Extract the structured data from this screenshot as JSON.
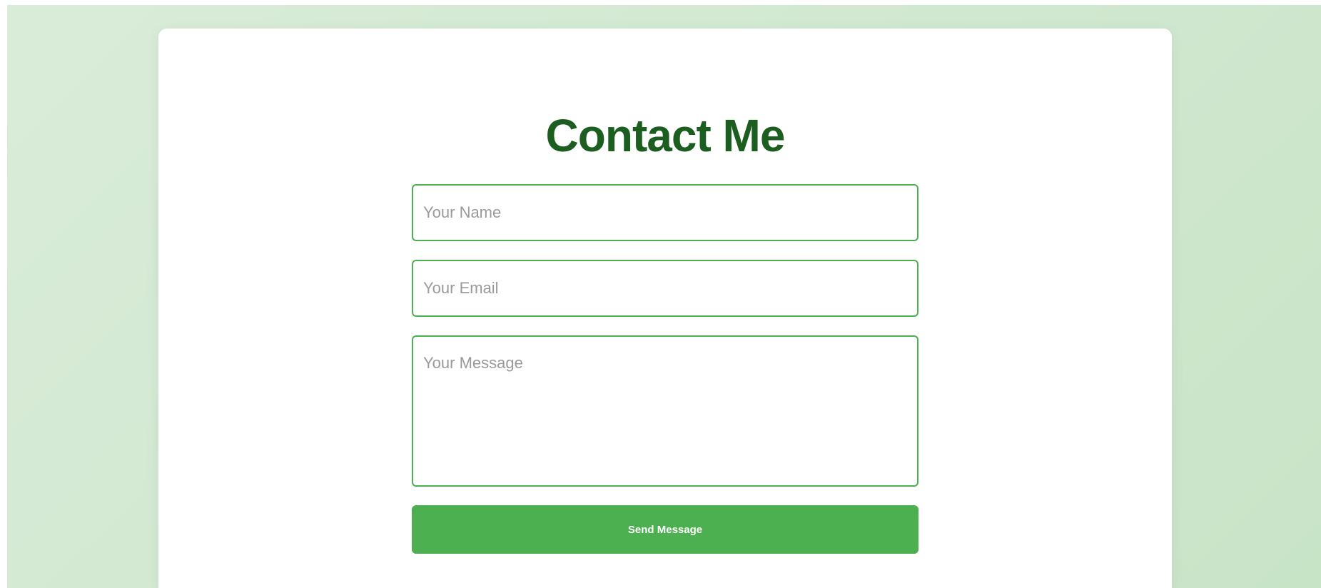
{
  "contact": {
    "title": "Contact Me",
    "name_placeholder": "Your Name",
    "email_placeholder": "Your Email",
    "message_placeholder": "Your Message",
    "submit_label": "Send Message"
  },
  "colors": {
    "accent": "#4caf50",
    "title": "#1b5e20",
    "background": "#d1e8d0"
  }
}
